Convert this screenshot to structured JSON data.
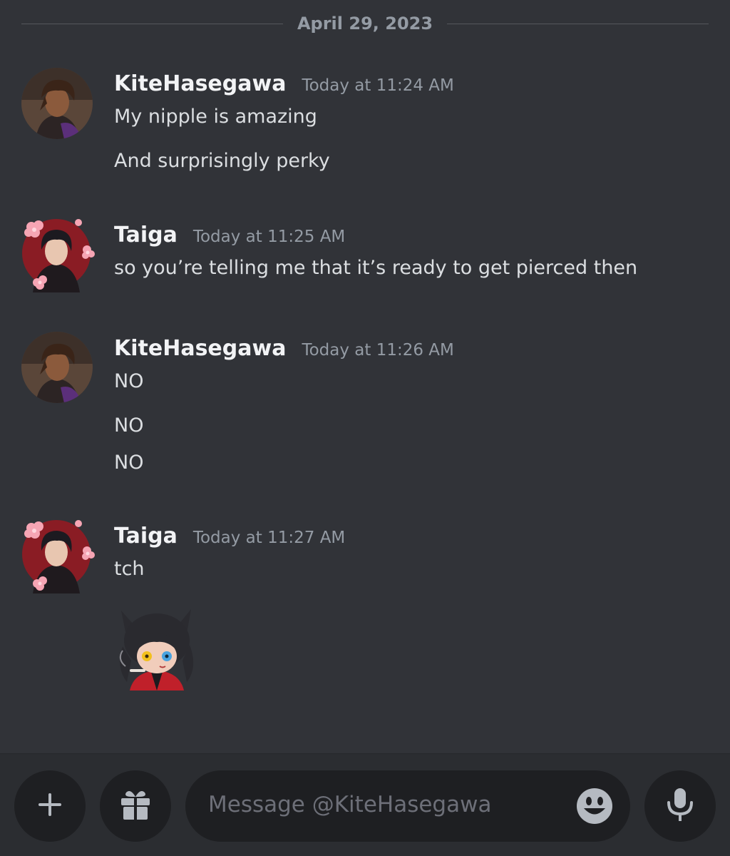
{
  "date_divider": "April 29, 2023",
  "messages": [
    {
      "username": "KiteHasegawa",
      "timestamp": "Today at 11:24 AM",
      "lines": [
        "My nipple is amazing",
        "And surprisingly perky"
      ]
    },
    {
      "username": "Taiga",
      "timestamp": "Today at 11:25 AM",
      "lines": [
        "so you’re telling me that it’s ready to get pierced then"
      ]
    },
    {
      "username": "KiteHasegawa",
      "timestamp": "Today at 11:26 AM",
      "lines": [
        "NO",
        "NO",
        "NO"
      ]
    },
    {
      "username": "Taiga",
      "timestamp": "Today at 11:27 AM",
      "lines": [
        "tch"
      ],
      "sticker": "chibi-character-sticker"
    }
  ],
  "composer": {
    "placeholder": "Message @KiteHasegawa",
    "attach_icon": "plus-icon",
    "gift_icon": "gift-icon",
    "emoji_icon": "smiley-icon",
    "voice_icon": "microphone-icon"
  },
  "colors": {
    "background": "#313338",
    "composer_bg": "#2b2d31",
    "input_bg": "#1e1f22",
    "username": "#f2f3f5",
    "message_text": "#dbdee1",
    "muted": "#949ba4",
    "icon": "#b5bac1"
  }
}
